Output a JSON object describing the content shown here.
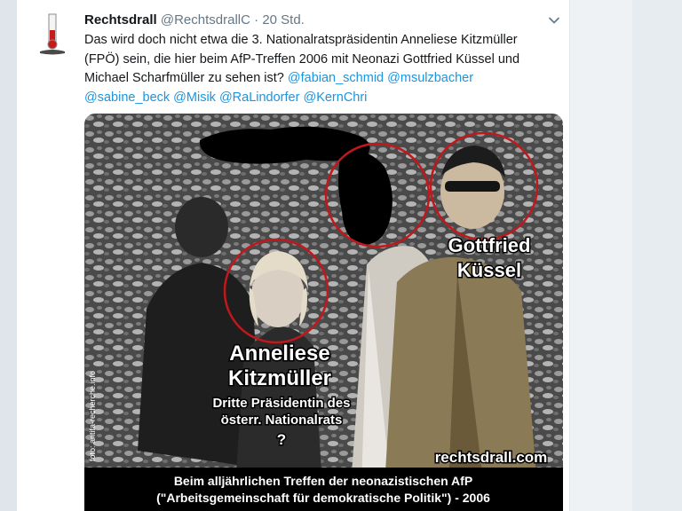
{
  "tweet": {
    "author_name": "Rechtsdrall",
    "handle": "@RechtsdrallC",
    "separator": "·",
    "time": "20 Std.",
    "text_plain": "Das wird doch nicht etwa die 3. Nationalratspräsidentin Anneliese Kitzmüller (FPÖ) sein, die hier beim AfP-Treffen 2006 mit Neonazi Gottfried Küssel und Michael Scharfmüller zu sehen ist?",
    "mentions": [
      "@fabian_schmid",
      "@msulzbacher",
      "@sabine_beck",
      "@Misik",
      "@RaLindorfer",
      "@KernChri"
    ]
  },
  "image": {
    "label_gottfried_line1": "Gottfried",
    "label_gottfried_line2": "Küssel",
    "label_anneliese_line1": "Anneliese",
    "label_anneliese_line2": "Kitzmüller",
    "subtitle_line1": "Dritte Präsidentin des",
    "subtitle_line2": "österr. Nationalrats",
    "question_mark": "?",
    "watermark": "rechtsdrall.com",
    "side_credit": "foto: antifa-recherche.info",
    "caption_line1": "Beim alljährlichen Treffen der neonazistischen AfP",
    "caption_line2": "(\"Arbeitsgemeinschaft für demokratische Politik\") - 2006"
  },
  "colors": {
    "link": "#1b95e0",
    "circle": "#c0181c",
    "caption_bg": "#000000"
  },
  "icons": {
    "avatar": "flask-logo-icon",
    "menu": "chevron-down-icon"
  }
}
